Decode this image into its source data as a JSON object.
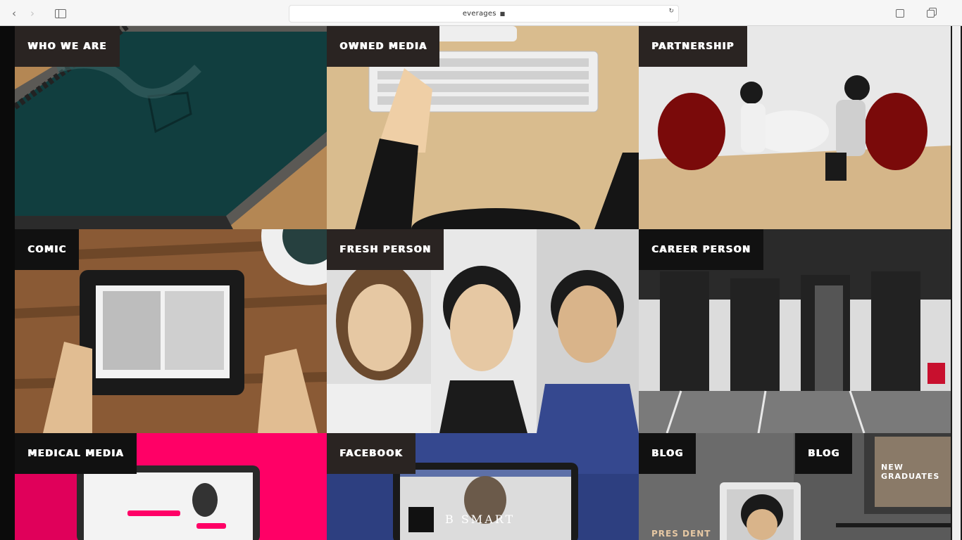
{
  "browser": {
    "url": "everages",
    "lock_icon": "lock-icon",
    "icons": [
      "chevron-left-icon",
      "chevron-right-icon",
      "sidebar-icon",
      "share-icon",
      "tabs-icon",
      "reload-icon"
    ]
  },
  "tiles": [
    {
      "label": "WHO WE ARE"
    },
    {
      "label": "OWNED MEDIA"
    },
    {
      "label": "PARTNERSHIP"
    },
    {
      "label": "COMIC"
    },
    {
      "label": "FRESH PERSON"
    },
    {
      "label": "CAREER PERSON"
    },
    {
      "label": "MEDICAL MEDIA"
    },
    {
      "label": "FACEBOOK"
    },
    {
      "label": "BLOG"
    }
  ],
  "blog": {
    "second_label": "BLOG",
    "new_graduates": "NEW\nGRADUATES",
    "president": "PRES DENT"
  },
  "facebook": {
    "brand": "B SMART"
  },
  "colors": {
    "label_bg": "#2a2422",
    "medical_pink": "#ff0066",
    "facebook_blue": "#35488f",
    "chair_red": "#7a0a0a"
  }
}
